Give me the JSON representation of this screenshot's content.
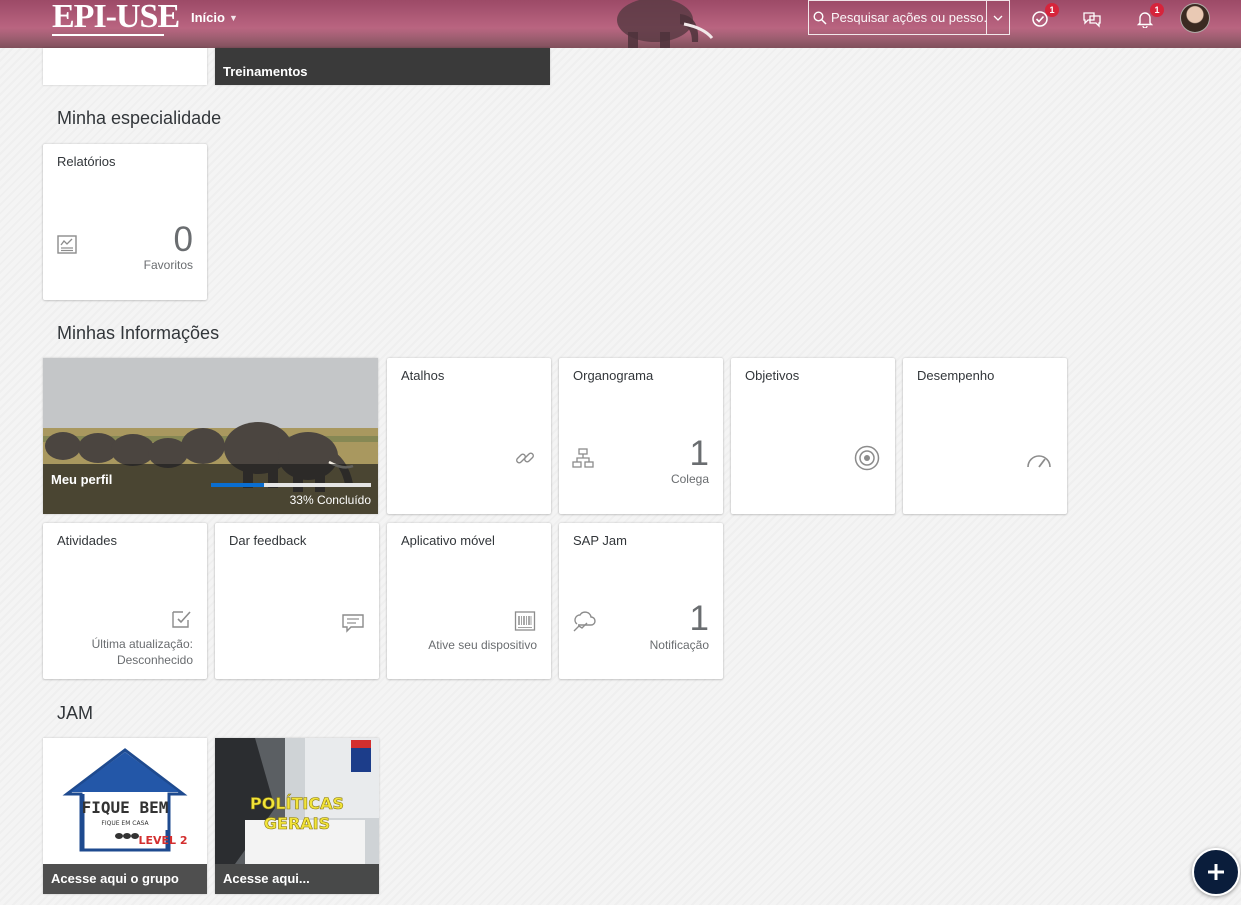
{
  "header": {
    "logo_text": "EPI-USE",
    "home_label": "Início",
    "search_placeholder": "Pesquisar ações ou pesso...",
    "todo_badge": "1",
    "notification_badge": "1"
  },
  "top_partial": {
    "training_label": "Treinamentos"
  },
  "sections": {
    "specialty_title": "Minha especialidade",
    "info_title": "Minhas Informações",
    "jam_title": "JAM"
  },
  "tiles": {
    "reports": {
      "title": "Relatórios",
      "value": "0",
      "footer": "Favoritos"
    },
    "profile": {
      "title": "Meu perfil",
      "progress": 33,
      "progress_text": "33% Concluído"
    },
    "shortcuts": {
      "title": "Atalhos"
    },
    "orgchart": {
      "title": "Organograma",
      "value": "1",
      "footer": "Colega"
    },
    "goals": {
      "title": "Objetivos"
    },
    "performance": {
      "title": "Desempenho"
    },
    "activities": {
      "title": "Atividades",
      "footer_line1": "Última atualização:",
      "footer_line2": "Desconhecido"
    },
    "feedback": {
      "title": "Dar feedback"
    },
    "mobile": {
      "title": "Aplicativo móvel",
      "footer": "Ative seu dispositivo"
    },
    "sapjam": {
      "title": "SAP Jam",
      "value": "1",
      "footer": "Notificação"
    }
  },
  "jam": {
    "group1": {
      "image_heading": "FIQUE BEM",
      "image_subtext": "FIQUE EM CASA",
      "image_level": "LEVEL 2",
      "footer": "Acesse aqui o grupo"
    },
    "group2": {
      "image_line1": "POLÍTICAS",
      "image_line2": "GERAIS",
      "footer": "Acesse aqui..."
    }
  },
  "colors": {
    "header_accent": "#b8637f",
    "progress": "#0a6ed1",
    "badge": "#d6243b",
    "fab": "#0a1d3b"
  }
}
